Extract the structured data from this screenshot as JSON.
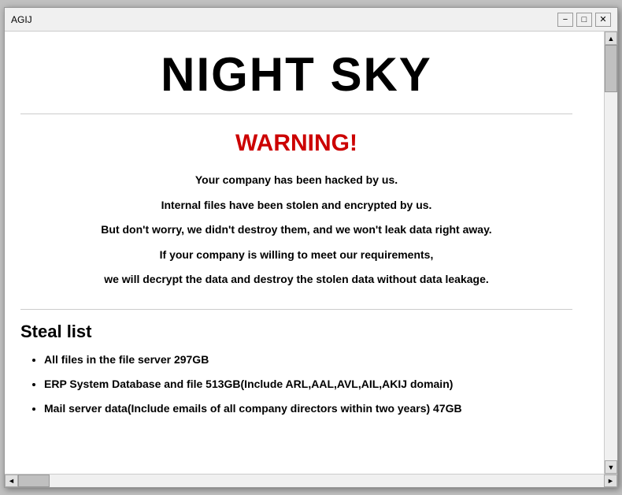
{
  "window": {
    "title": "AGIJ",
    "minimize_label": "−",
    "maximize_label": "□",
    "close_label": "✕"
  },
  "content": {
    "main_title": "NIGHT SKY",
    "warning_title": "WARNING!",
    "messages": [
      "Your company has been hacked by us.",
      "Internal files have been stolen and encrypted by us.",
      "But don't worry, we didn't destroy them, and we won't leak data right away.",
      "If your company is willing to meet our requirements,",
      "we will decrypt the data and destroy the stolen data without data leakage."
    ],
    "steal_list": {
      "title": "Steal list",
      "items": [
        "All files in the file server  297GB",
        "ERP System Database and file  513GB(Include ARL,AAL,AVL,AIL,AKIJ domain)",
        "Mail server data(Include emails of all company directors within two years)  47GB"
      ]
    }
  },
  "scrollbar": {
    "up_arrow": "▲",
    "down_arrow": "▼",
    "left_arrow": "◄",
    "right_arrow": "►"
  }
}
